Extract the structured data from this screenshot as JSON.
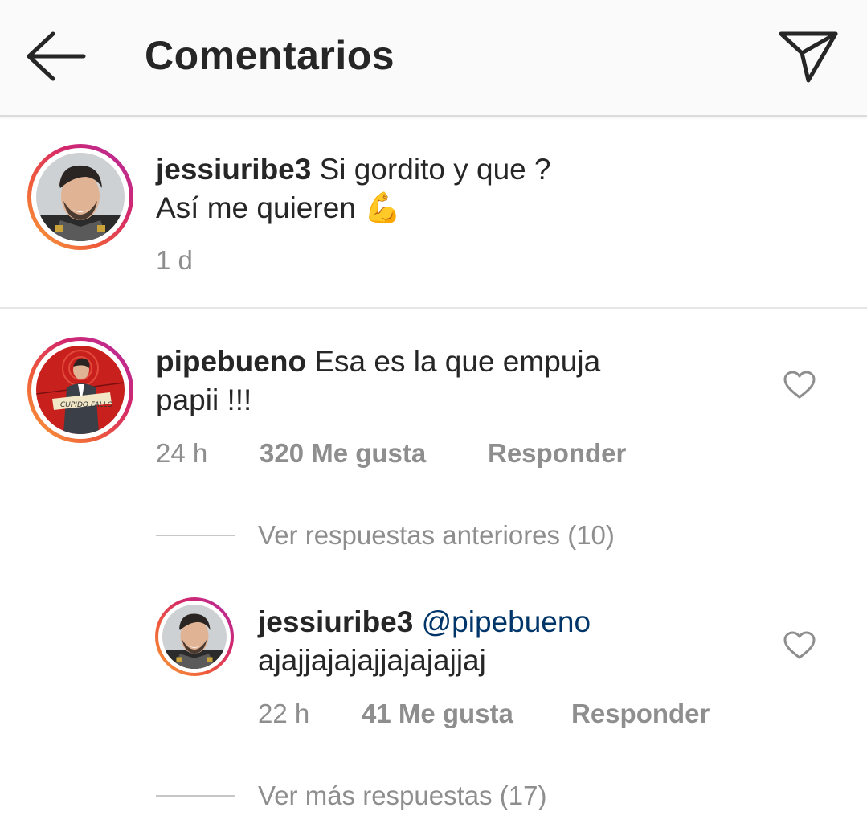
{
  "header": {
    "title": "Comentarios",
    "back_icon": "arrow-left-icon",
    "share_icon": "paper-plane-icon"
  },
  "caption": {
    "username": "jessiuribe3",
    "text_line1": "Si gordito y que ?",
    "text_line2": "Así me quieren 💪",
    "time": "1 d"
  },
  "comment": {
    "username": "pipebueno",
    "text_line1": "Esa es la que empuja",
    "text_line2": "papii !!!",
    "time": "24 h",
    "likes": "320 Me gusta",
    "reply": "Responder",
    "heart_icon": "heart-outline-icon"
  },
  "view_previous": "Ver respuestas anteriores (10)",
  "reply": {
    "username": "jessiuribe3",
    "mention": "@pipebueno",
    "text_line2": "ajajjajajajjajajajjaj",
    "time": "22 h",
    "likes": "41 Me gusta",
    "reply": "Responder",
    "heart_icon": "heart-outline-icon"
  },
  "view_more": "Ver más respuestas (17)",
  "colors": {
    "mention": "#003569",
    "meta": "#8e8e8e",
    "text": "#262626",
    "header_bg": "#fafafa"
  }
}
